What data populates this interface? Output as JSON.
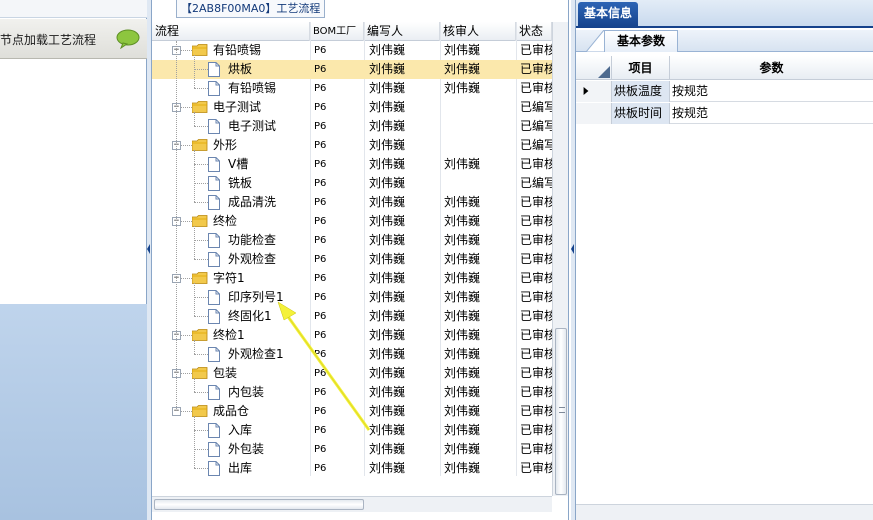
{
  "left": {
    "header_label": "节点加载工艺流程"
  },
  "middle": {
    "title": "【2AB8F00MA0】工艺流程",
    "columns": {
      "flow": "流程",
      "bom": "BOM工厂",
      "editor": "编写人",
      "reviewer": "核审人",
      "status": "状态"
    },
    "rows": [
      {
        "label": "有铅喷锡",
        "bom": "P6",
        "editor": "刘伟巍",
        "reviewer": "刘伟巍",
        "status": "已审核"
      },
      {
        "label": "烘板",
        "bom": "P6",
        "editor": "刘伟巍",
        "reviewer": "刘伟巍",
        "status": "已审核"
      },
      {
        "label": "有铅喷锡",
        "bom": "P6",
        "editor": "刘伟巍",
        "reviewer": "刘伟巍",
        "status": "已审核"
      },
      {
        "label": "电子测试",
        "bom": "P6",
        "editor": "刘伟巍",
        "reviewer": "",
        "status": "已编写"
      },
      {
        "label": "电子测试",
        "bom": "P6",
        "editor": "刘伟巍",
        "reviewer": "",
        "status": "已编写"
      },
      {
        "label": "外形",
        "bom": "P6",
        "editor": "刘伟巍",
        "reviewer": "",
        "status": "已编写"
      },
      {
        "label": "V槽",
        "bom": "P6",
        "editor": "刘伟巍",
        "reviewer": "刘伟巍",
        "status": "已审核"
      },
      {
        "label": "铣板",
        "bom": "P6",
        "editor": "刘伟巍",
        "reviewer": "",
        "status": "已编写"
      },
      {
        "label": "成品清洗",
        "bom": "P6",
        "editor": "刘伟巍",
        "reviewer": "刘伟巍",
        "status": "已审核"
      },
      {
        "label": "终检",
        "bom": "P6",
        "editor": "刘伟巍",
        "reviewer": "刘伟巍",
        "status": "已审核"
      },
      {
        "label": "功能检查",
        "bom": "P6",
        "editor": "刘伟巍",
        "reviewer": "刘伟巍",
        "status": "已审核"
      },
      {
        "label": "外观检查",
        "bom": "P6",
        "editor": "刘伟巍",
        "reviewer": "刘伟巍",
        "status": "已审核"
      },
      {
        "label": "字符1",
        "bom": "P6",
        "editor": "刘伟巍",
        "reviewer": "刘伟巍",
        "status": "已审核"
      },
      {
        "label": "印序列号1",
        "bom": "P6",
        "editor": "刘伟巍",
        "reviewer": "刘伟巍",
        "status": "已审核"
      },
      {
        "label": "终固化1",
        "bom": "P6",
        "editor": "刘伟巍",
        "reviewer": "刘伟巍",
        "status": "已审核"
      },
      {
        "label": "终检1",
        "bom": "P6",
        "editor": "刘伟巍",
        "reviewer": "刘伟巍",
        "status": "已审核"
      },
      {
        "label": "外观检查1",
        "bom": "P6",
        "editor": "刘伟巍",
        "reviewer": "刘伟巍",
        "status": "已审核"
      },
      {
        "label": "包装",
        "bom": "P6",
        "editor": "刘伟巍",
        "reviewer": "刘伟巍",
        "status": "已审核"
      },
      {
        "label": "内包装",
        "bom": "P6",
        "editor": "刘伟巍",
        "reviewer": "刘伟巍",
        "status": "已审核"
      },
      {
        "label": "成品仓",
        "bom": "P6",
        "editor": "刘伟巍",
        "reviewer": "刘伟巍",
        "status": "已审核"
      },
      {
        "label": "入库",
        "bom": "P6",
        "editor": "刘伟巍",
        "reviewer": "刘伟巍",
        "status": "已审核"
      },
      {
        "label": "外包装",
        "bom": "P6",
        "editor": "刘伟巍",
        "reviewer": "刘伟巍",
        "status": "已审核"
      },
      {
        "label": "出库",
        "bom": "P6",
        "editor": "刘伟巍",
        "reviewer": "刘伟巍",
        "status": "已审核"
      }
    ]
  },
  "right": {
    "tab": "基本信息",
    "subtab": "基本参数",
    "headers": {
      "item": "项目",
      "param": "参数"
    },
    "rows": [
      {
        "item": "烘板温度",
        "value": "按规范"
      },
      {
        "item": "烘板时间",
        "value": "按规范"
      }
    ]
  },
  "colors": {
    "accent": "#15428b",
    "selection": "#fbe8ac",
    "arrow": "#f4f13a",
    "folder": "#f2c94c"
  }
}
